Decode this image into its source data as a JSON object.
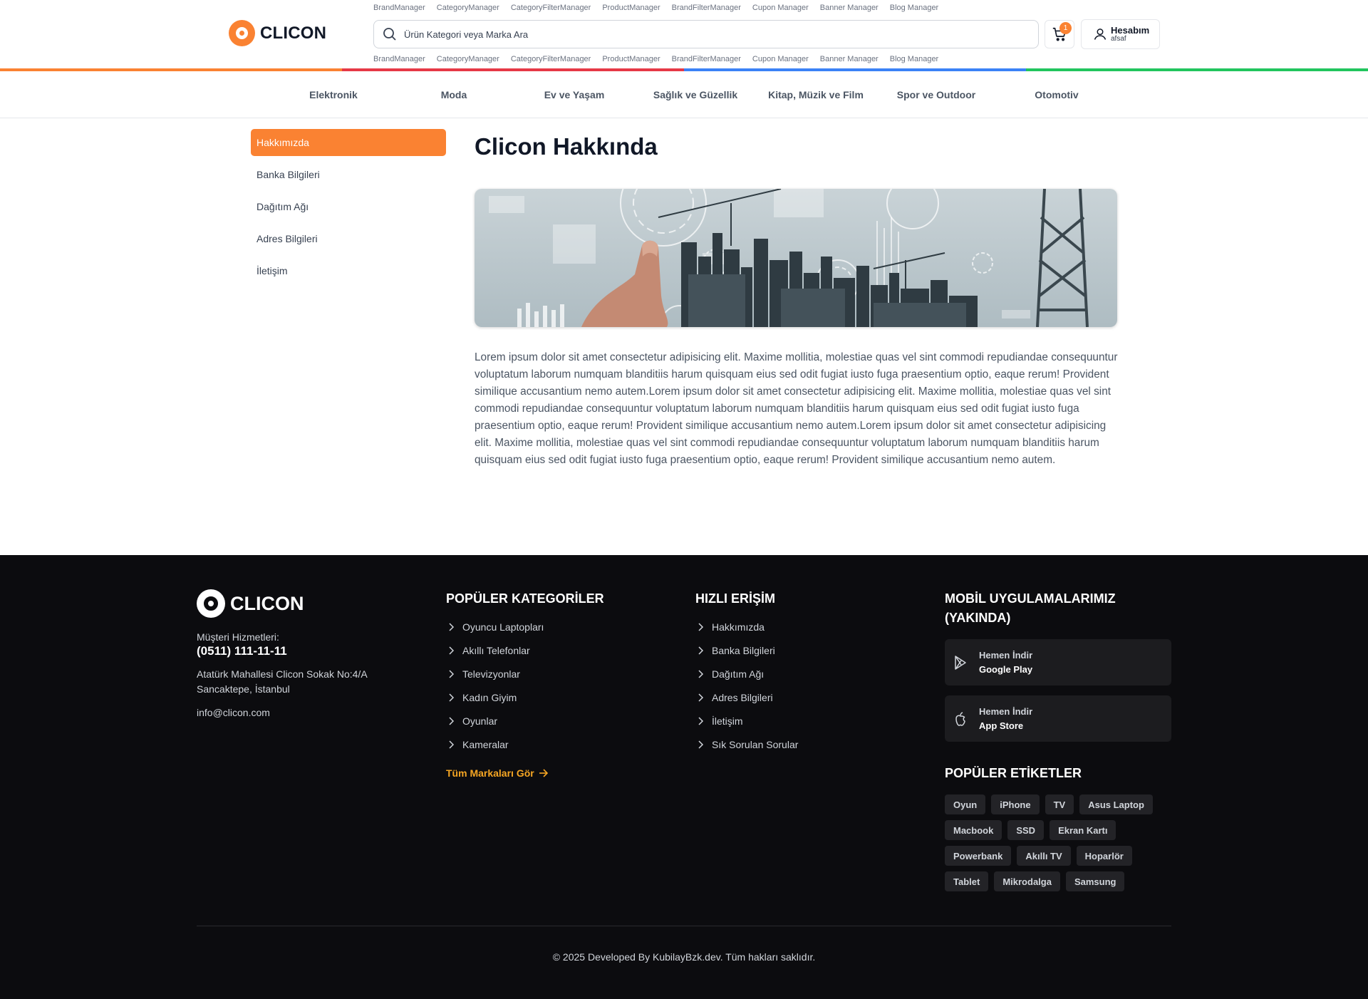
{
  "header": {
    "admin_links": [
      "BrandManager",
      "CategoryManager",
      "CategoryFilterManager",
      "ProductManager",
      "BrandFilterManager",
      "Cupon Manager",
      "Banner Manager",
      "Blog Manager"
    ],
    "logo_text": "CLICON",
    "search_placeholder": "Ürün Kategori veya Marka Ara",
    "cart_count": "1",
    "account_label": "Hesabım",
    "account_user": "afsaf",
    "bar_colors": [
      "#fa8232",
      "#e63946",
      "#3b82f6",
      "#22c55e"
    ]
  },
  "categories": [
    "Elektronik",
    "Moda",
    "Ev ve Yaşam",
    "Sağlık ve Güzellik",
    "Kitap, Müzik ve Film",
    "Spor ve Outdoor",
    "Otomotiv"
  ],
  "sidebar": {
    "items": [
      "Hakkımızda",
      "Banka Bilgileri",
      "Dağıtım Ağı",
      "Adres Bilgileri",
      "İletişim"
    ],
    "active_index": 0
  },
  "main": {
    "title": "Clicon Hakkında",
    "body": "Lorem ipsum dolor sit amet consectetur adipisicing elit. Maxime mollitia, molestiae quas vel sint commodi repudiandae consequuntur voluptatum laborum numquam blanditiis harum quisquam eius sed odit fugiat iusto fuga praesentium optio, eaque rerum! Provident similique accusantium nemo autem.Lorem ipsum dolor sit amet consectetur adipisicing elit. Maxime mollitia, molestiae quas vel sint commodi repudiandae consequuntur voluptatum laborum numquam blanditiis harum quisquam eius sed odit fugiat iusto fuga praesentium optio, eaque rerum! Provident similique accusantium nemo autem.Lorem ipsum dolor sit amet consectetur adipisicing elit. Maxime mollitia, molestiae quas vel sint commodi repudiandae consequuntur voluptatum laborum numquam blanditiis harum quisquam eius sed odit fugiat iusto fuga praesentium optio, eaque rerum! Provident similique accusantium nemo autem."
  },
  "footer": {
    "logo_text": "CLICON",
    "support_label": "Müşteri Hizmetleri:",
    "phone": "(0511) 111-11-11",
    "address_line1": "Atatürk Mahallesi Clicon Sokak No:4/A",
    "address_line2": "Sancaktepe, İstanbul",
    "email": "info@clicon.com",
    "popular_title": "POPÜLER KATEGORİLER",
    "popular_items": [
      "Oyuncu Laptopları",
      "Akıllı Telefonlar",
      "Televizyonlar",
      "Kadın Giyim",
      "Oyunlar",
      "Kameralar"
    ],
    "all_brands": "Tüm Markaları Gör",
    "quick_title": "HIZLI ERİŞİM",
    "quick_items": [
      "Hakkımızda",
      "Banka Bilgileri",
      "Dağıtım Ağı",
      "Adres Bilgileri",
      "İletişim",
      "Sık Sorulan Sorular"
    ],
    "apps_title_line1": "MOBİL UYGULAMALARIMIZ",
    "apps_title_line2": "(YAKINDA)",
    "google_line1": "Hemen İndir",
    "google_line2": "Google Play",
    "apple_line1": "Hemen İndir",
    "apple_line2": "App Store",
    "tags_title": "POPÜLER ETİKETLER",
    "tags": [
      "Oyun",
      "iPhone",
      "TV",
      "Asus Laptop",
      "Macbook",
      "SSD",
      "Ekran Kartı",
      "Powerbank",
      "Akıllı TV",
      "Hoparlör",
      "Tablet",
      "Mikrodalga",
      "Samsung"
    ],
    "copyright": "© 2025 Developed By KubilayBzk.dev. Tüm hakları saklıdır.",
    "accent_color": "#f6a623"
  }
}
